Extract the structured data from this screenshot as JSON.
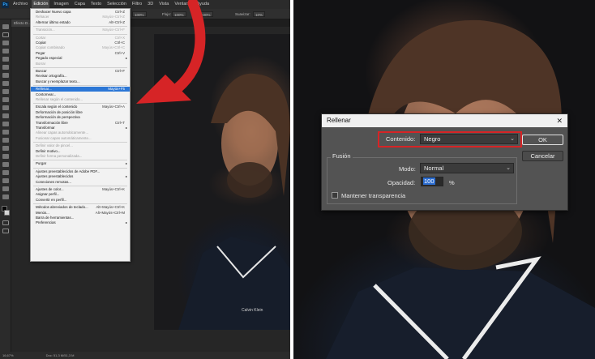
{
  "menubar": {
    "logo": "Ps",
    "items": [
      "Archivo",
      "Edición",
      "Imagen",
      "Capa",
      "Texto",
      "Selección",
      "Filtro",
      "3D",
      "Vista",
      "Ventana",
      "Ayuda"
    ]
  },
  "optbar": {
    "zoom1": "100%",
    "flujo_label": "Flujo:",
    "flujo": "100%",
    "zoom2": "100%",
    "suav_label": "Suavizar:",
    "suav": "10%"
  },
  "doctab": "Efecto D...",
  "statusbar": {
    "zoom": "16,67%",
    "doc": "Doc: 51,3 M/51,3 M"
  },
  "edit_menu": {
    "items": [
      {
        "label": "Deshacer Nuevo capa",
        "shortcut": "Ctrl+Z",
        "disabled": false
      },
      {
        "label": "Rehacer",
        "shortcut": "Mayús+Ctrl+Z",
        "disabled": true
      },
      {
        "label": "Alternar último estado",
        "shortcut": "Alt+Ctrl+Z",
        "disabled": false
      },
      {
        "sep": true
      },
      {
        "label": "Transición...",
        "shortcut": "Mayús+Ctrl+F",
        "disabled": true
      },
      {
        "sep": true
      },
      {
        "label": "Cortar",
        "shortcut": "Ctrl+X",
        "disabled": true
      },
      {
        "label": "Copiar",
        "shortcut": "Ctrl+C",
        "disabled": false
      },
      {
        "label": "Copiar combinado",
        "shortcut": "Mayús+Ctrl+C",
        "disabled": true
      },
      {
        "label": "Pegar",
        "shortcut": "Ctrl+V",
        "disabled": false
      },
      {
        "label": "Pegado especial",
        "shortcut": "",
        "disabled": false,
        "submenu": true
      },
      {
        "label": "Borrar",
        "shortcut": "",
        "disabled": true
      },
      {
        "sep": true
      },
      {
        "label": "Buscar",
        "shortcut": "Ctrl+F",
        "disabled": false
      },
      {
        "label": "Revisar ortografía...",
        "shortcut": "",
        "disabled": false
      },
      {
        "label": "Buscar y reemplazar texto...",
        "shortcut": "",
        "disabled": false
      },
      {
        "sep": true
      },
      {
        "label": "Rellenar...",
        "shortcut": "Mayús+F5",
        "disabled": false,
        "highlight": true
      },
      {
        "label": "Contornear...",
        "shortcut": "",
        "disabled": false
      },
      {
        "label": "Rellenar según el contenido...",
        "shortcut": "",
        "disabled": true
      },
      {
        "sep": true
      },
      {
        "label": "Escala según el contenido",
        "shortcut": "Mayús+Ctrl+A",
        "disabled": false
      },
      {
        "label": "Deformación de posición libre",
        "shortcut": "",
        "disabled": false
      },
      {
        "label": "Deformación de perspectiva",
        "shortcut": "",
        "disabled": false
      },
      {
        "label": "Transformación libre",
        "shortcut": "Ctrl+T",
        "disabled": false
      },
      {
        "label": "Transformar",
        "shortcut": "",
        "disabled": false,
        "submenu": true
      },
      {
        "label": "Alinear capas automáticamente...",
        "shortcut": "",
        "disabled": true
      },
      {
        "label": "Fusionar capas automáticamente...",
        "shortcut": "",
        "disabled": true
      },
      {
        "sep": true
      },
      {
        "label": "Definir valor de pincel...",
        "shortcut": "",
        "disabled": true
      },
      {
        "label": "Definir motivo...",
        "shortcut": "",
        "disabled": false
      },
      {
        "label": "Definir forma personalizada...",
        "shortcut": "",
        "disabled": true
      },
      {
        "sep": true
      },
      {
        "label": "Purgar",
        "shortcut": "",
        "disabled": false,
        "submenu": true
      },
      {
        "sep": true
      },
      {
        "label": "Ajustes preestablecidos de Adobe PDF...",
        "shortcut": "",
        "disabled": false
      },
      {
        "label": "Ajustes preestablecidos",
        "shortcut": "",
        "disabled": false,
        "submenu": true
      },
      {
        "label": "Conexiones remotas...",
        "shortcut": "",
        "disabled": false
      },
      {
        "sep": true
      },
      {
        "label": "Ajustes de color...",
        "shortcut": "Mayús+Ctrl+K",
        "disabled": false
      },
      {
        "label": "Asignar perfil...",
        "shortcut": "",
        "disabled": false
      },
      {
        "label": "Convertir en perfil...",
        "shortcut": "",
        "disabled": false
      },
      {
        "sep": true
      },
      {
        "label": "Métodos abreviados de teclado...",
        "shortcut": "Alt+Mayús+Ctrl+K",
        "disabled": false
      },
      {
        "label": "Menús...",
        "shortcut": "Alt+Mayús+Ctrl+M",
        "disabled": false
      },
      {
        "label": "Barra de herramientas...",
        "shortcut": "",
        "disabled": false
      },
      {
        "label": "Preferencias",
        "shortcut": "",
        "disabled": false,
        "submenu": true
      }
    ]
  },
  "dialog": {
    "title": "Rellenar",
    "close": "✕",
    "contenido_label": "Contenido:",
    "contenido_value": "Negro",
    "fusion_label": "Fusión",
    "modo_label": "Modo:",
    "modo_value": "Normal",
    "opacidad_label": "Opacidad:",
    "opacidad_value": "100",
    "opacidad_unit": "%",
    "mantener_label": "Mantener transparencia",
    "mantener_checked": false,
    "ok_label": "OK",
    "cancel_label": "Cancelar"
  },
  "photo_left_text": "Calvin Klein",
  "colors": {
    "arrow": "#d62426",
    "highlight": "#2c77d6",
    "dialog_bg": "#535353"
  }
}
